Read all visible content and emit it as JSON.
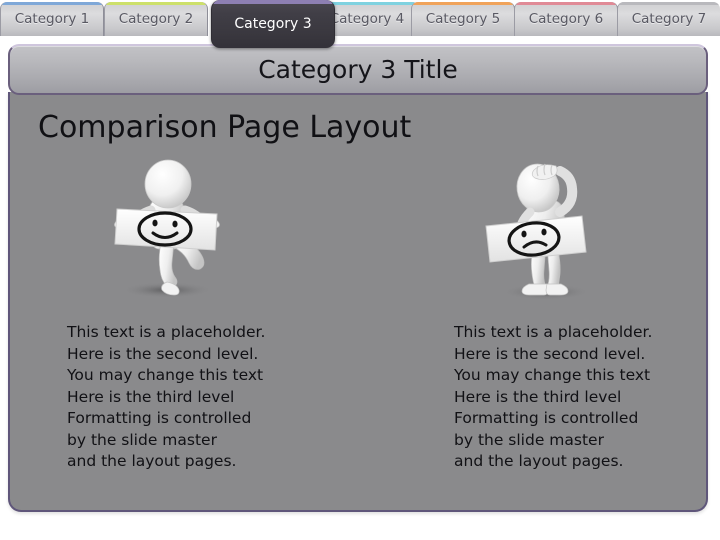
{
  "slide": {
    "background_color": "#8a8a8c",
    "border_color": "#5f567a",
    "heading": "Comparison Page Layout"
  },
  "tabs": {
    "active_index": 2,
    "items": [
      {
        "label": "Category 1",
        "accent_color": "#7fa8d8",
        "active": false
      },
      {
        "label": "Category 2",
        "accent_color": "#cde06a",
        "active": false
      },
      {
        "label": "Category 3",
        "accent_color": "#8d7fb2",
        "active": true
      },
      {
        "label": "Category 4",
        "accent_color": "#7fd2e0",
        "active": false
      },
      {
        "label": "Category 5",
        "accent_color": "#f0a35a",
        "active": false
      },
      {
        "label": "Category 6",
        "accent_color": "#e08a96",
        "active": false
      },
      {
        "label": "Category 7",
        "accent_color": "#b9b9bd",
        "active": false
      }
    ]
  },
  "title_bar": {
    "title": "Category 3 Title",
    "border_color": "#6a5f7d"
  },
  "columns": [
    {
      "id": "left",
      "figure": {
        "icon_name": "happy-figure-illustration",
        "expression": "smiley-face",
        "description": "3D white figure holding a sign with a smiling face"
      },
      "lines": [
        "This text is a placeholder.",
        "Here is the second level.",
        "You may change this text",
        "Here is the third level",
        "Formatting is controlled",
        "by the slide master",
        "and the layout pages."
      ]
    },
    {
      "id": "right",
      "figure": {
        "icon_name": "sad-figure-illustration",
        "expression": "frowny-face",
        "description": "3D white figure with hand on head holding a sign with a frowning face"
      },
      "lines": [
        "This text is a placeholder.",
        "Here is the second level.",
        "You may change this text",
        "Here is the third level",
        "Formatting is controlled",
        "by the slide master",
        "and the layout pages."
      ]
    }
  ]
}
